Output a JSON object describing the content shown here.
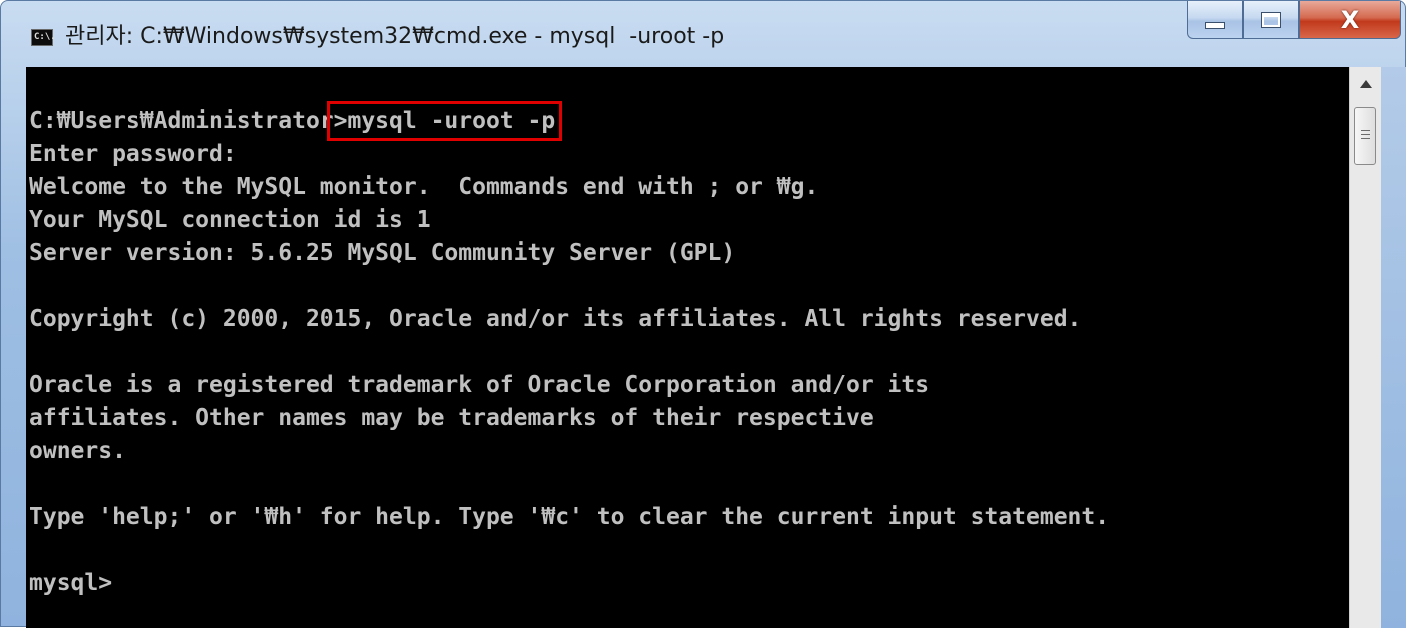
{
  "window": {
    "title": "관리자: C:₩Windows₩system32₩cmd.exe - mysql  -uroot -p",
    "icon_label": "C:\\.",
    "close_glyph": "X"
  },
  "console": {
    "prompt_prefix": "C:₩Users₩Administrator",
    "command": ">mysql -uroot -p",
    "lines": [
      "Enter password:",
      "Welcome to the MySQL monitor.  Commands end with ; or ₩g.",
      "Your MySQL connection id is 1",
      "Server version: 5.6.25 MySQL Community Server (GPL)",
      "",
      "Copyright (c) 2000, 2015, Oracle and/or its affiliates. All rights reserved.",
      "",
      "Oracle is a registered trademark of Oracle Corporation and/or its",
      "affiliates. Other names may be trademarks of their respective",
      "owners.",
      "",
      "Type 'help;' or '₩h' for help. Type '₩c' to clear the current input statement.",
      "",
      "mysql>"
    ]
  },
  "colors": {
    "console_background": "#000000",
    "console_text": "#c0c0c0",
    "highlight_box": "#e00000",
    "close_button": "#c2391c"
  },
  "icons": {
    "app": "cmd-console-icon",
    "minimize": "minimize-icon",
    "maximize": "maximize-icon",
    "close": "close-icon",
    "scroll_up": "scroll-up-arrow-icon",
    "scroll_grip": "grip-icon"
  }
}
